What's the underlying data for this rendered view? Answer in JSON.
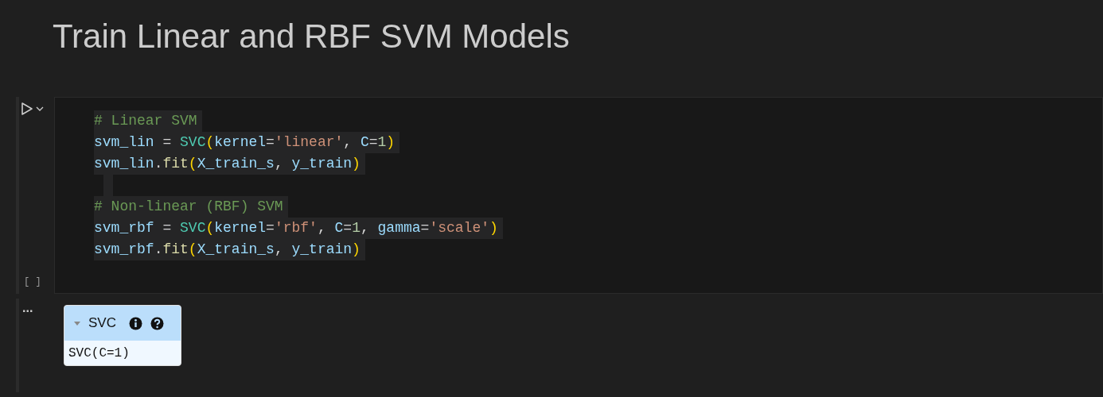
{
  "heading": "Train Linear and RBF SVM Models",
  "cell": {
    "run_label": "[ ]",
    "code_lines": [
      {
        "tokens": [
          {
            "kind": "comment",
            "text": "# Linear SVM"
          }
        ]
      },
      {
        "tokens": [
          {
            "kind": "var",
            "text": "svm_lin"
          },
          {
            "kind": "plain",
            "text": " = "
          },
          {
            "kind": "func",
            "text": "SVC"
          },
          {
            "kind": "paren",
            "text": "("
          },
          {
            "kind": "var",
            "text": "kernel"
          },
          {
            "kind": "plain",
            "text": "="
          },
          {
            "kind": "string",
            "text": "'linear'"
          },
          {
            "kind": "plain",
            "text": ", "
          },
          {
            "kind": "var",
            "text": "C"
          },
          {
            "kind": "plain",
            "text": "="
          },
          {
            "kind": "number",
            "text": "1"
          },
          {
            "kind": "paren",
            "text": ")"
          }
        ]
      },
      {
        "tokens": [
          {
            "kind": "var",
            "text": "svm_lin"
          },
          {
            "kind": "plain",
            "text": "."
          },
          {
            "kind": "method",
            "text": "fit"
          },
          {
            "kind": "paren",
            "text": "("
          },
          {
            "kind": "var",
            "text": "X_train_s"
          },
          {
            "kind": "plain",
            "text": ", "
          },
          {
            "kind": "var",
            "text": "y_train"
          },
          {
            "kind": "paren",
            "text": ")"
          }
        ]
      },
      {
        "kind": "blank"
      },
      {
        "tokens": [
          {
            "kind": "comment",
            "text": "# Non-linear (RBF) SVM"
          }
        ]
      },
      {
        "tokens": [
          {
            "kind": "var",
            "text": "svm_rbf"
          },
          {
            "kind": "plain",
            "text": " = "
          },
          {
            "kind": "func",
            "text": "SVC"
          },
          {
            "kind": "paren",
            "text": "("
          },
          {
            "kind": "var",
            "text": "kernel"
          },
          {
            "kind": "plain",
            "text": "="
          },
          {
            "kind": "string",
            "text": "'rbf'"
          },
          {
            "kind": "plain",
            "text": ", "
          },
          {
            "kind": "var",
            "text": "C"
          },
          {
            "kind": "plain",
            "text": "="
          },
          {
            "kind": "number",
            "text": "1"
          },
          {
            "kind": "plain",
            "text": ", "
          },
          {
            "kind": "var",
            "text": "gamma"
          },
          {
            "kind": "plain",
            "text": "="
          },
          {
            "kind": "string",
            "text": "'scale'"
          },
          {
            "kind": "paren",
            "text": ")"
          }
        ]
      },
      {
        "tokens": [
          {
            "kind": "var",
            "text": "svm_rbf"
          },
          {
            "kind": "plain",
            "text": "."
          },
          {
            "kind": "method",
            "text": "fit"
          },
          {
            "kind": "paren",
            "text": "("
          },
          {
            "kind": "var",
            "text": "X_train_s"
          },
          {
            "kind": "plain",
            "text": ", "
          },
          {
            "kind": "var",
            "text": "y_train"
          },
          {
            "kind": "paren",
            "text": ")"
          }
        ]
      }
    ]
  },
  "output": {
    "more_label": "...",
    "estimator": {
      "name": "SVC",
      "repr": "SVC(C=1)",
      "expanded": true
    }
  }
}
